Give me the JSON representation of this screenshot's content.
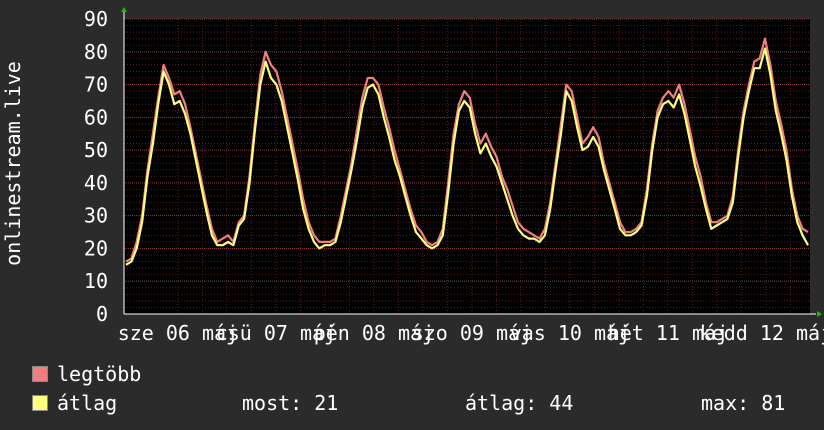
{
  "chart_data": {
    "type": "line",
    "ylabel": "onlinestream.live",
    "yticks": [
      0,
      10,
      20,
      30,
      40,
      50,
      60,
      70,
      80,
      90
    ],
    "ylim": [
      0,
      90
    ],
    "xtick_labels": [
      "sze 06 máj",
      "csü 07 máj",
      "pén 08 máj",
      "szo 09 máj",
      "vas 10 máj",
      "hét 11 máj",
      "kedd 12 máj"
    ],
    "grid": true,
    "series": [
      {
        "name": "legtöbb",
        "color": "#f08080",
        "values": [
          16,
          17,
          22,
          30,
          44,
          55,
          66,
          76,
          72,
          67,
          68,
          64,
          57,
          49,
          41,
          33,
          26,
          22,
          23,
          24,
          22,
          28,
          30,
          42,
          58,
          73,
          80,
          76,
          74,
          68,
          60,
          52,
          44,
          35,
          28,
          24,
          22,
          22,
          22,
          23,
          30,
          38,
          46,
          56,
          66,
          72,
          72,
          70,
          63,
          57,
          50,
          44,
          38,
          32,
          27,
          25,
          22,
          21,
          22,
          26,
          40,
          55,
          64,
          68,
          66,
          58,
          52,
          55,
          51,
          48,
          42,
          38,
          33,
          28,
          26,
          25,
          24,
          23,
          26,
          34,
          46,
          58,
          70,
          68,
          60,
          52,
          54,
          57,
          54,
          46,
          40,
          34,
          28,
          25,
          25,
          26,
          28,
          38,
          52,
          62,
          66,
          68,
          66,
          70,
          64,
          56,
          48,
          42,
          34,
          28,
          28,
          29,
          30,
          36,
          50,
          62,
          70,
          77,
          78,
          84,
          76,
          65,
          58,
          50,
          38,
          30,
          26,
          25
        ]
      },
      {
        "name": "átlag",
        "color": "#ffff80",
        "values": [
          15,
          16,
          20,
          28,
          42,
          52,
          64,
          74,
          70,
          64,
          65,
          61,
          55,
          47,
          39,
          31,
          24,
          21,
          21,
          22,
          21,
          27,
          29,
          40,
          56,
          70,
          77,
          72,
          70,
          65,
          57,
          49,
          41,
          32,
          26,
          22,
          20,
          21,
          21,
          22,
          28,
          36,
          44,
          53,
          63,
          69,
          70,
          67,
          60,
          54,
          47,
          42,
          36,
          30,
          25,
          23,
          21,
          20,
          21,
          24,
          37,
          52,
          62,
          65,
          63,
          55,
          49,
          52,
          48,
          45,
          40,
          35,
          30,
          26,
          24,
          23,
          23,
          22,
          24,
          32,
          44,
          55,
          68,
          65,
          57,
          50,
          51,
          54,
          51,
          44,
          38,
          32,
          26,
          24,
          24,
          25,
          27,
          36,
          50,
          60,
          64,
          65,
          63,
          67,
          61,
          53,
          45,
          39,
          32,
          26,
          27,
          28,
          29,
          34,
          48,
          60,
          68,
          75,
          75,
          81,
          73,
          62,
          55,
          47,
          36,
          28,
          24,
          21
        ]
      }
    ]
  },
  "legend": {
    "max_label": "legtöbb",
    "avg_label": "átlag",
    "now": "most: 21",
    "avg": "átlag: 44",
    "max": "max: 81"
  }
}
